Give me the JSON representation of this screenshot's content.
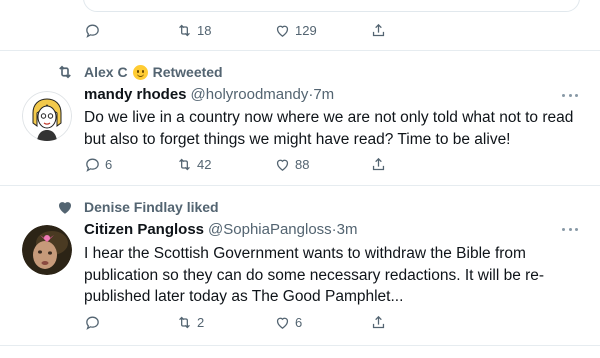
{
  "prev_tweet": {
    "actions": {
      "reply": "",
      "retweet": "18",
      "like": "129"
    }
  },
  "tweet1": {
    "social_prefix": "Alex C",
    "social_suffix": "Retweeted",
    "name": "mandy rhodes",
    "handle": "@holyroodmandy",
    "separator": "·",
    "time": "7m",
    "text": "Do we live in a country now where we are not only told what not to read but also to forget things we might have read? Time to be alive!",
    "actions": {
      "reply": "6",
      "retweet": "42",
      "like": "88"
    }
  },
  "tweet2": {
    "social": "Denise Findlay liked",
    "name": "Citizen Pangloss",
    "handle": "@SophiaPangloss",
    "separator": "·",
    "time": "3m",
    "text": "I hear the Scottish Government wants to withdraw the Bible from publication so they can do some necessary redactions. It will be re-published later today as The Good Pamphlet...",
    "actions": {
      "reply": "",
      "retweet": "2",
      "like": "6"
    }
  },
  "colors": {
    "text": "#0f1419",
    "muted": "#536471",
    "divider": "#e6ecf0"
  }
}
